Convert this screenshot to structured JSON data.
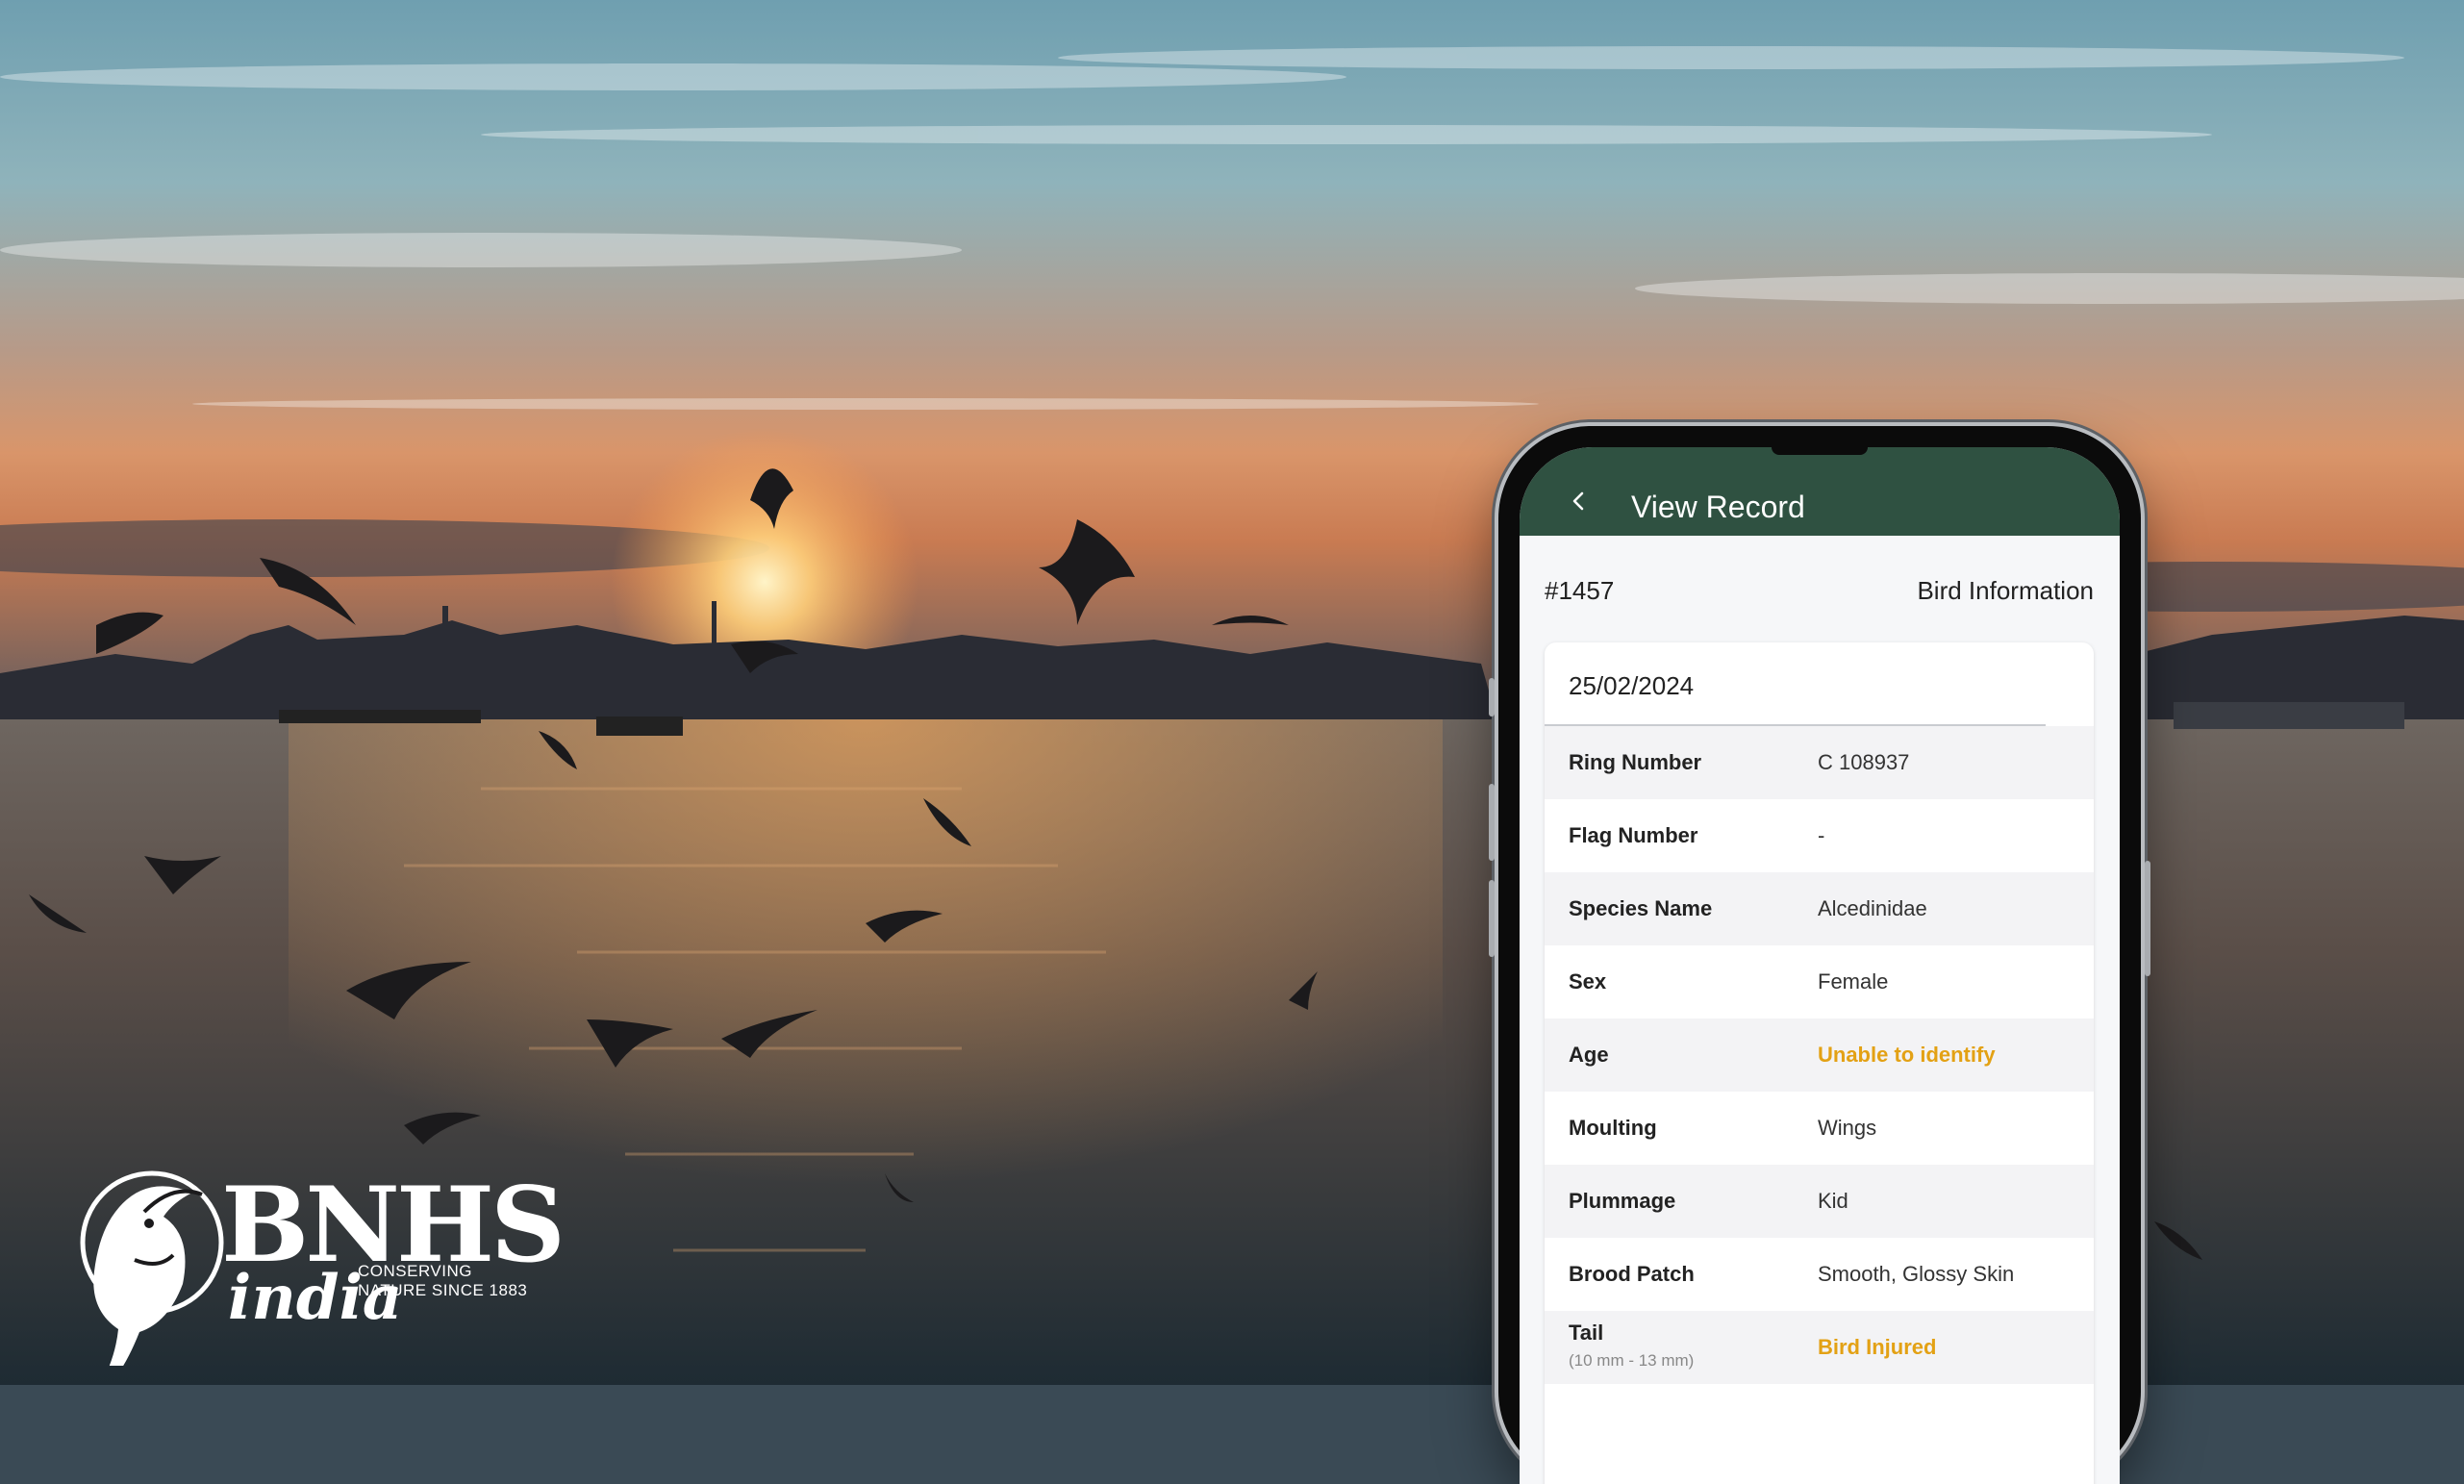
{
  "logo": {
    "name": "BNHS",
    "sub": "india",
    "tagline_1": "CONSERVING",
    "tagline_2": "NATURE SINCE 1883"
  },
  "app_bar": {
    "back_icon": "chevron-left-icon",
    "title": "View Record"
  },
  "record": {
    "id": "#1457",
    "type": "Bird Information",
    "date": "25/02/2024"
  },
  "fields": [
    {
      "label": "Ring Number",
      "value": "C 108937"
    },
    {
      "label": "Flag Number",
      "value": "-"
    },
    {
      "label": "Species Name",
      "value": "Alcedinidae"
    },
    {
      "label": "Sex",
      "value": "Female"
    },
    {
      "label": "Age",
      "value": "Unable to identify",
      "status": "warning"
    },
    {
      "label": "Moulting",
      "value": "Wings"
    },
    {
      "label": "Plummage",
      "value": "Kid"
    },
    {
      "label": "Brood Patch",
      "value": "Smooth, Glossy Skin"
    },
    {
      "label": "Tail",
      "sub": "(10 mm - 13 mm)",
      "value": "Bird Injured",
      "status": "warning"
    }
  ],
  "colors": {
    "app_bar": "#2f5141",
    "warning": "#e3a114"
  }
}
